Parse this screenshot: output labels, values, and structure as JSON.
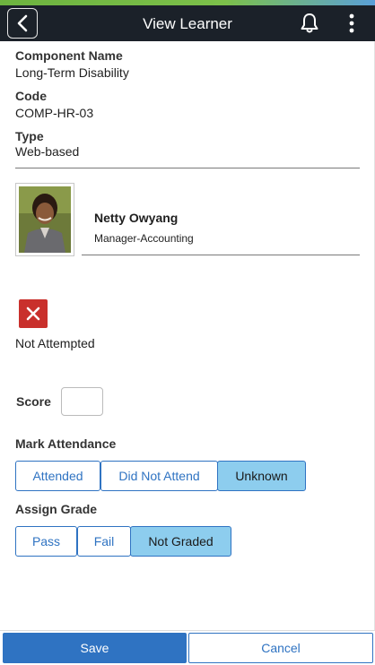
{
  "header": {
    "title": "View Learner",
    "back_icon": "chevron-left-icon",
    "notification_icon": "bell-icon",
    "menu_icon": "kebab-menu-icon"
  },
  "details": {
    "component_name_label": "Component Name",
    "component_name_value": "Long-Term Disability",
    "code_label": "Code",
    "code_value": "COMP-HR-03",
    "type_label": "Type",
    "type_value": "Web-based"
  },
  "learner": {
    "name": "Netty Owyang",
    "title": "Manager-Accounting"
  },
  "status": {
    "icon": "x-icon",
    "text": "Not Attempted",
    "color": "#c9302c"
  },
  "score": {
    "label": "Score",
    "value": ""
  },
  "attendance": {
    "label": "Mark Attendance",
    "options": [
      "Attended",
      "Did Not Attend",
      "Unknown"
    ],
    "selected": "Unknown"
  },
  "grade": {
    "label": "Assign Grade",
    "options": [
      "Pass",
      "Fail",
      "Not Graded"
    ],
    "selected": "Not Graded"
  },
  "footer": {
    "save_label": "Save",
    "cancel_label": "Cancel"
  },
  "colors": {
    "header_bg": "#1b2129",
    "accent": "#2f73c2",
    "selected_bg": "#8dcdee"
  }
}
